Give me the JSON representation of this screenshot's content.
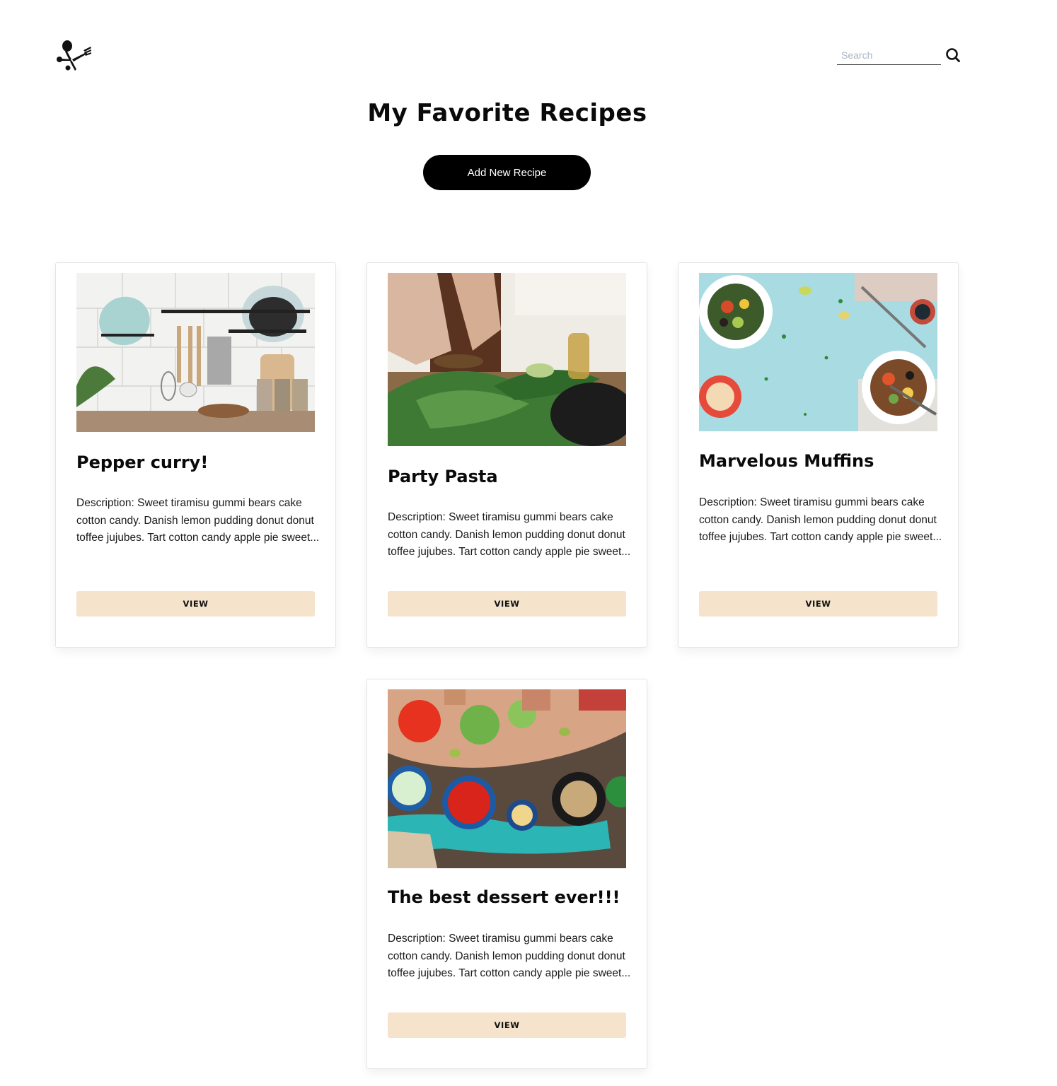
{
  "header": {
    "logo_icon": "fork-spoon-icon",
    "search": {
      "placeholder": "Search",
      "value": ""
    },
    "search_icon": "search-icon"
  },
  "main": {
    "title": "My Favorite Recipes",
    "add_button_label": "Add New Recipe"
  },
  "recipes": [
    {
      "title": "Pepper curry!",
      "description": "Description: Sweet tiramisu gummi bears cake cotton candy. Danish lemon pudding donut donut toffee jujubes. Tart cotton candy apple pie sweet...",
      "button_label": "VIEW",
      "image_subject": "kitchen wall with hanging utensils"
    },
    {
      "title": "Party Pasta",
      "description": "Description: Sweet tiramisu gummi bears cake cotton candy. Danish lemon pudding donut donut toffee jujubes. Tart cotton candy apple pie sweet...",
      "button_label": "VIEW",
      "image_subject": "person chopping vegetables"
    },
    {
      "title": "Marvelous Muffins",
      "description": "Description: Sweet tiramisu gummi bears cake cotton candy. Danish lemon pudding donut donut toffee jujubes. Tart cotton candy apple pie sweet...",
      "button_label": "VIEW",
      "image_subject": "salad bowls on light blue table"
    },
    {
      "title": "The best dessert ever!!!",
      "description": "Description: Sweet tiramisu gummi bears cake cotton candy. Danish lemon pudding donut donut toffee jujubes. Tart cotton candy apple pie sweet...",
      "button_label": "VIEW",
      "image_subject": "overhead view of cooking table with bowls"
    }
  ],
  "colors": {
    "accent_button": "#f5e3cb",
    "primary_button": "#000000",
    "text": "#0a0a0a"
  }
}
